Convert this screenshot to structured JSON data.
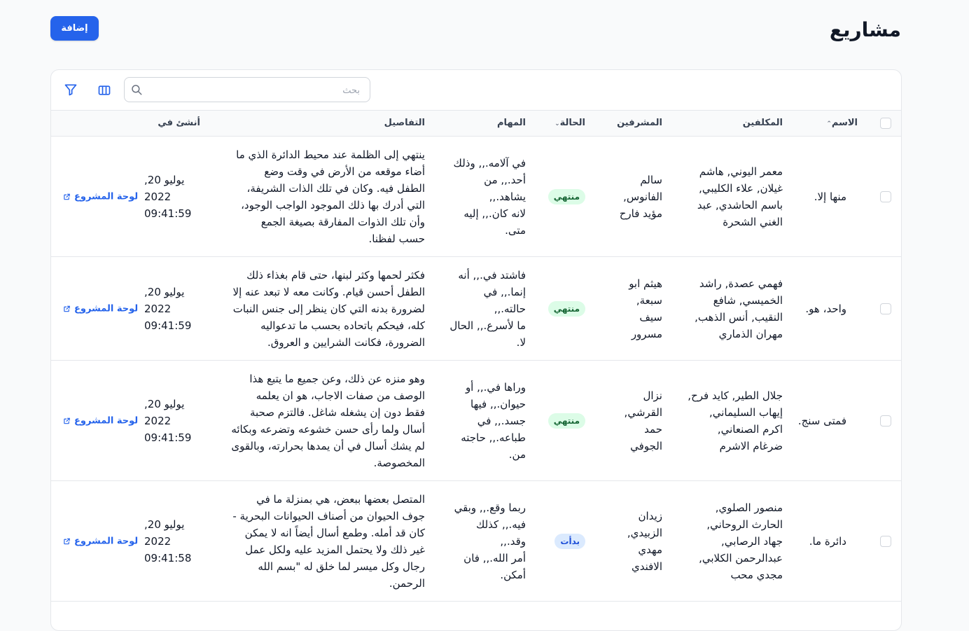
{
  "page": {
    "title": "مشاريع",
    "add_label": "إضافة"
  },
  "search": {
    "placeholder": "بحث"
  },
  "columns": {
    "name": "الاسم",
    "assignees": "المكلفين",
    "supervisors": "المشرفين",
    "status": "الحالة",
    "tasks": "المهام",
    "details": "التفاصيل",
    "created": "أنشئ في"
  },
  "colors": {
    "accent": "#2563eb",
    "done_bg": "#dcfce7",
    "done_fg": "#166534",
    "started_bg": "#dbeafe",
    "started_fg": "#1d4ed8"
  },
  "icons": {
    "search": "search-icon",
    "columns": "columns-icon",
    "filter": "filter-icon",
    "link": "external-link-icon"
  },
  "rows": [
    {
      "name": "منها إلا.",
      "assignees": [
        "معمر اليوني, هاشم",
        "غيلان, علاء الكليبي,",
        "باسم الحاشدي, عبد",
        "الغني الشحرة"
      ],
      "supervisors": [
        "سالم",
        "الفانوس,",
        "مؤيد فارح"
      ],
      "status": "منتهي",
      "status_type": "done",
      "tasks": [
        "في آلامه.,, وذلك",
        "أحد.,, من يشاهد.,,",
        "لانه كان.,, إليه",
        "متى."
      ],
      "details": [
        "ينتهي إلى الظلمة عند محيط الدائرة الذي ما",
        "أضاء موقعه من الأرض في وقت وضع",
        "الطفل فيه. وكان في تلك الذات الشريفة،",
        "التي أدرك بها ذلك الموجود الواجب الوجود،",
        "وأن تلك الذوات المفارقة بصيغة الجمع",
        "حسب لفظنا."
      ],
      "date": [
        "يوليو 20,",
        "2022",
        "09:41:59"
      ],
      "link": "لوحة المشروع"
    },
    {
      "name": "واحد، هو.",
      "assignees": [
        "فهمي عصدة, راشد",
        "الخميسي, شافع",
        "النقيب, أنس الذهب,",
        "مهران الذماري"
      ],
      "supervisors": [
        "هيثم ابو",
        "سبعة,",
        "سيف",
        "مسرور"
      ],
      "status": "منتهي",
      "status_type": "done",
      "tasks": [
        "فاشتد في.,, أنه",
        "إنما.,, في حالته.,,",
        "ما لأسرع.,, الحال",
        "لا."
      ],
      "details": [
        "فكثر لحمها وكثر لبنها، حتى قام بغذاء ذلك",
        "الطفل أحسن قيام. وكانت معه لا تبعد عنه إلا",
        "لضرورة بدنه التي كان ينظر إلى جنس النبات",
        "كله، فيحكم باتحاده بحسب ما تدعواليه",
        "الضرورة، فكانت الشرايين و العروق."
      ],
      "date": [
        "يوليو 20,",
        "2022",
        "09:41:59"
      ],
      "link": "لوحة المشروع"
    },
    {
      "name": "فمتى سنج.",
      "assignees": [
        "جلال الطير, كايد فرح,",
        "إيهاب السليماني,",
        "اكرم الصنعاني,",
        "ضرغام الاشرم"
      ],
      "supervisors": [
        "نزال",
        "القرشي,",
        "حمد",
        "الجوفي"
      ],
      "status": "منتهي",
      "status_type": "done",
      "tasks": [
        "وراها في.,, أو",
        "حيوان.,, فيها",
        "جسد.,, في",
        "طباعه.,, حاجته",
        "من."
      ],
      "details": [
        "وهو منزه عن ذلك، وعن جميع ما يتبع هذا",
        "الوصف من صفات الاجاب، هو ان يعلمه",
        "فقط دون إن يشغله شاغل. فالتزم صحبة",
        "أسال ولما رأى حسن خشوعه وتضرعه وبكائه",
        "لم يشك أسال في أن يمدها بحرارته، وبالقوى",
        "المخصوصة."
      ],
      "date": [
        "يوليو 20,",
        "2022",
        "09:41:59"
      ],
      "link": "لوحة المشروع"
    },
    {
      "name": "دائرة ما.",
      "assignees": [
        "منصور الصلوي,",
        "الحارث الروحاني,",
        "جهاد الرصابي,",
        "عبدالرحمن الكلابي,",
        "مجدي محب"
      ],
      "supervisors": [
        "زيدان",
        "الزبيدي,",
        "مهدي",
        "الافندي"
      ],
      "status": "بدأت",
      "status_type": "started",
      "tasks": [
        "ربما وقع.,, وبقي",
        "فيه.,, كذلك وقد.,,",
        "أمر الله.,, فان",
        "أمكن."
      ],
      "details": [
        "المتصل بعضها ببعض، هي بمنزلة ما في",
        "جوف الحيوان من أصناف الحيوانات البحرية -",
        "كان قد أمله. وطمع أسال أيضاً انه لا يمكن",
        "غير ذلك ولا يحتمل المزيد عليه ولكل عمل",
        "رجال وكل ميسر لما خلق له \"بسم الله",
        "الرحمن."
      ],
      "date": [
        "يوليو 20,",
        "2022",
        "09:41:58"
      ],
      "link": "لوحة المشروع"
    }
  ]
}
